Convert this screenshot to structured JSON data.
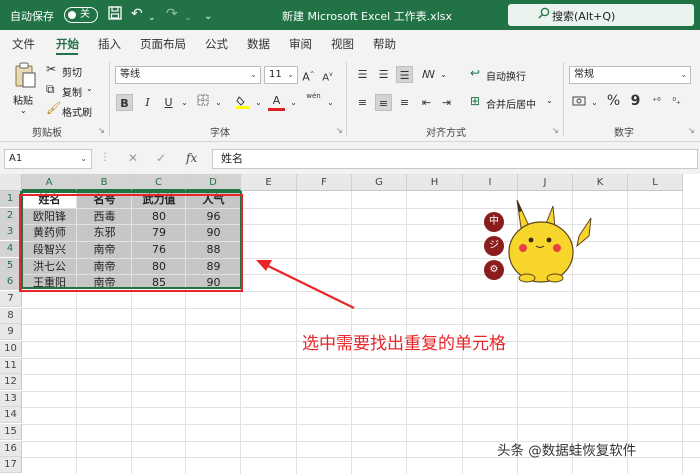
{
  "titlebar": {
    "autosave_label": "自动保存",
    "autosave_state": "关",
    "save_icon": "save-icon",
    "undo_icon": "undo-icon",
    "redo_icon": "redo-icon",
    "doc_title": "新建 Microsoft Excel 工作表.xlsx",
    "search_placeholder": "搜索(Alt+Q)",
    "accent": "#217346"
  },
  "tabs": [
    {
      "label": "文件"
    },
    {
      "label": "开始",
      "active": true
    },
    {
      "label": "插入"
    },
    {
      "label": "页面布局"
    },
    {
      "label": "公式"
    },
    {
      "label": "数据"
    },
    {
      "label": "审阅"
    },
    {
      "label": "视图"
    },
    {
      "label": "帮助"
    }
  ],
  "ribbon": {
    "clipboard": {
      "paste": "粘贴",
      "cut": "剪切",
      "copy": "复制",
      "format_painter": "格式刷",
      "group": "剪贴板"
    },
    "font": {
      "name": "等线",
      "size": "11",
      "bold": "B",
      "italic": "I",
      "underline": "U",
      "font_color_letter": "A",
      "wen": "wén",
      "group": "字体"
    },
    "alignment": {
      "wrap": "自动换行",
      "merge": "合并后居中",
      "group": "对齐方式"
    },
    "number": {
      "format": "常规",
      "percent": "%",
      "comma": "9",
      "group": "数字"
    }
  },
  "formula_bar": {
    "name_box": "A1",
    "fx": "fx",
    "content": "姓名"
  },
  "sheet": {
    "columns": [
      "A",
      "B",
      "C",
      "D",
      "E",
      "F",
      "G",
      "H",
      "I",
      "J",
      "K",
      "L"
    ],
    "rows": [
      "1",
      "2",
      "3",
      "4",
      "5",
      "6",
      "7",
      "8",
      "9",
      "10",
      "11",
      "12",
      "13",
      "14",
      "15",
      "16",
      "17"
    ],
    "headers": [
      "姓名",
      "名号",
      "武力值",
      "人气"
    ],
    "data": [
      [
        "欧阳锋",
        "西毒",
        "80",
        "96"
      ],
      [
        "黄药师",
        "东邪",
        "79",
        "90"
      ],
      [
        "段智兴",
        "南帝",
        "76",
        "88"
      ],
      [
        "洪七公",
        "南帝",
        "80",
        "89"
      ],
      [
        "王重阳",
        "南帝",
        "85",
        "90"
      ]
    ]
  },
  "annotation": {
    "text": "选中需要找出重复的单元格",
    "color": "#e8262a"
  },
  "watermark": "头条 @数据蛙恢复软件",
  "sticker": {
    "badges": [
      "中",
      "ジ",
      "⚙"
    ]
  }
}
